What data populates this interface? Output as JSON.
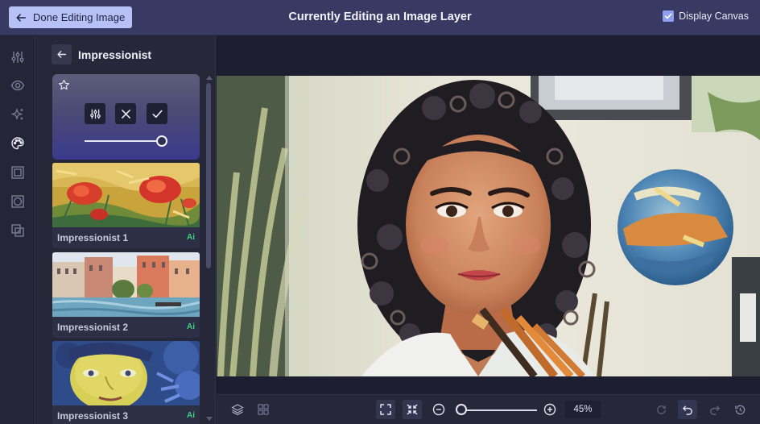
{
  "topbar": {
    "done_label": "Done Editing Image",
    "title": "Currently Editing an Image Layer",
    "display_canvas_label": "Display Canvas",
    "display_canvas_checked": true
  },
  "rail": {
    "icons": [
      "adjustments-icon",
      "eye-icon",
      "sparkles-icon",
      "palette-icon",
      "frame-icon",
      "vignette-icon",
      "layers-overlap-icon"
    ],
    "active": "palette-icon"
  },
  "panel": {
    "title": "Impressionist",
    "filters": [
      {
        "label": "Impressionist 1",
        "badge": "Ai"
      },
      {
        "label": "Impressionist 2",
        "badge": "Ai"
      },
      {
        "label": "Impressionist 3",
        "badge": "Ai"
      }
    ],
    "intensity": 1.0
  },
  "bottombar": {
    "zoom": "45%"
  },
  "colors": {
    "topbar": "#383a63",
    "accent": "#b7c1f5",
    "ai_badge": "#3ed37d"
  }
}
